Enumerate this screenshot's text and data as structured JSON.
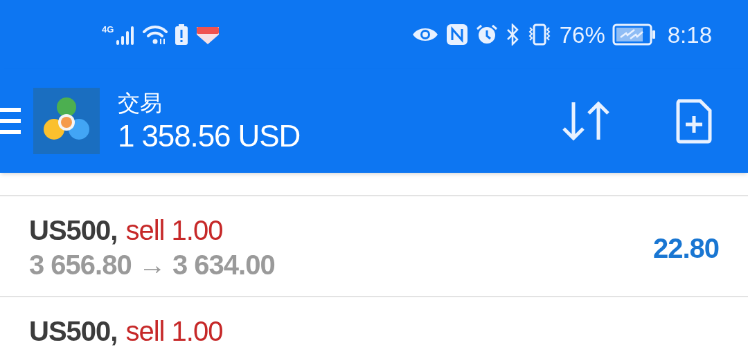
{
  "status_bar": {
    "network": "4G",
    "battery_percent": "76%",
    "time": "8:18"
  },
  "app_bar": {
    "title": "交易",
    "balance": "1 358.56 USD"
  },
  "positions": [
    {
      "symbol": "US500,",
      "side": "sell 1.00",
      "prices": "3 656.80 → 3 634.00",
      "profit": "22.80"
    },
    {
      "symbol": "US500,",
      "side": "sell 1.00"
    }
  ]
}
